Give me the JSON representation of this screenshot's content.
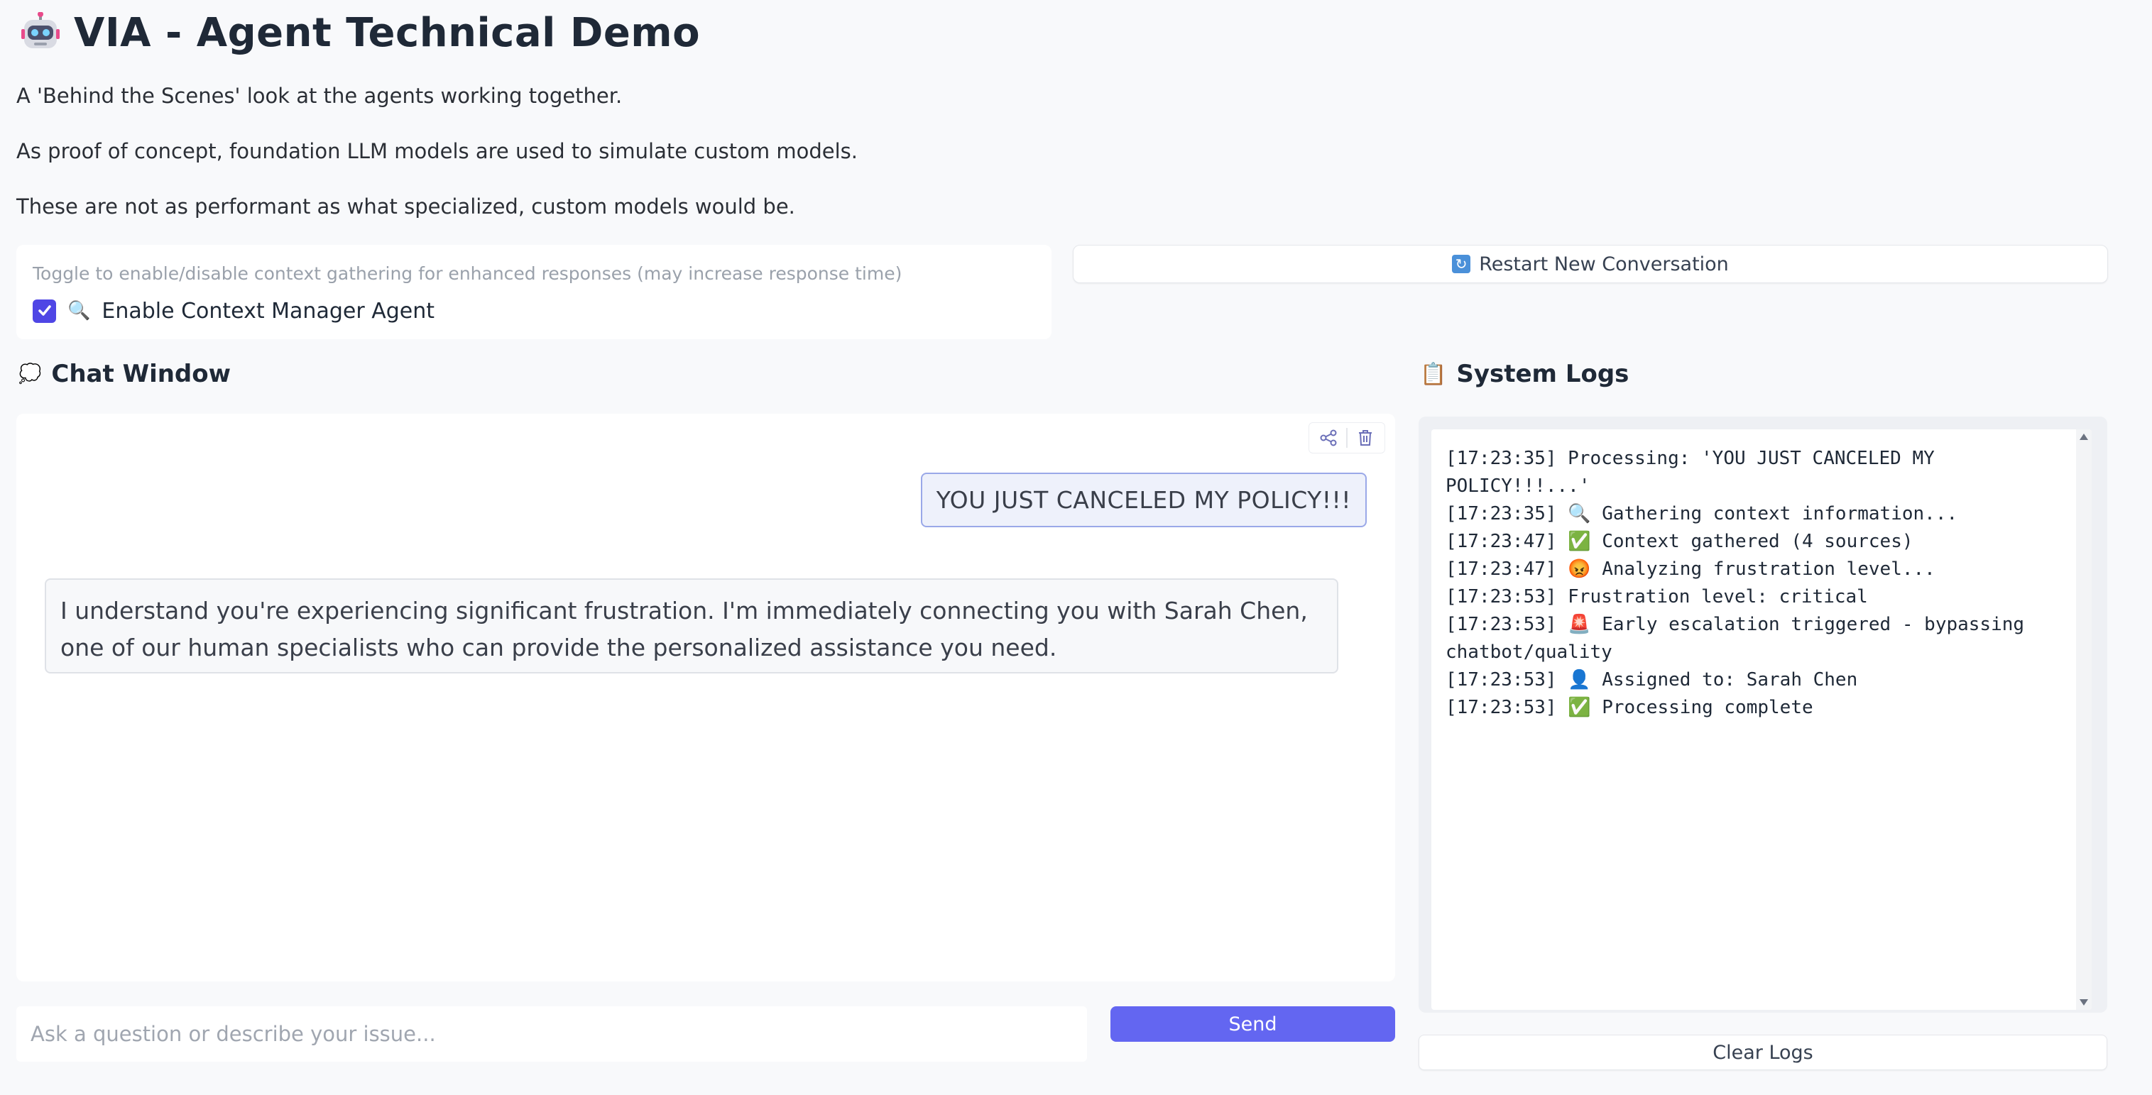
{
  "header": {
    "title": "VIA - Agent Technical Demo",
    "icon": "robot-icon",
    "descriptions": [
      "A 'Behind the Scenes' look at the agents working together.",
      "As proof of concept, foundation LLM models are used to simulate custom models.",
      "These are not as performant as what specialized, custom models would be."
    ]
  },
  "context_toggle": {
    "hint": "Toggle to enable/disable context gathering for enhanced responses (may increase response time)",
    "checked": true,
    "icon": "magnifier-icon",
    "icon_glyph": "🔍",
    "label": "Enable Context Manager Agent"
  },
  "restart": {
    "icon": "refresh-icon",
    "icon_glyph": "🔄",
    "label": "Restart New Conversation"
  },
  "chat": {
    "heading": "Chat Window",
    "heading_icon": "speech-bubble-icon",
    "heading_icon_glyph": "💭",
    "toolbar": [
      "share-icon",
      "trash-icon"
    ],
    "messages": [
      {
        "role": "user",
        "text": "YOU JUST CANCELED MY POLICY!!!"
      },
      {
        "role": "assistant",
        "text": "I understand you're experiencing significant frustration. I'm immediately connecting you with Sarah Chen, one of our human specialists who can provide the personalized assistance you need."
      }
    ],
    "input_placeholder": "Ask a question or describe your issue...",
    "input_value": "",
    "send_label": "Send"
  },
  "logs": {
    "heading": "System Logs",
    "heading_icon": "clipboard-icon",
    "heading_icon_glyph": "📋",
    "text": "[17:23:35] Processing: 'YOU JUST CANCELED MY POLICY!!!...'\n[17:23:35] 🔍 Gathering context information...\n[17:23:47] ✅ Context gathered (4 sources)\n[17:23:47] 😡 Analyzing frustration level...\n[17:23:53] Frustration level: critical\n[17:23:53] 🚨 Early escalation triggered - bypassing chatbot/quality\n[17:23:53] 👤 Assigned to: Sarah Chen\n[17:23:53] ✅ Processing complete",
    "clear_label": "Clear Logs"
  },
  "colors": {
    "accent": "#6366f1",
    "checkbox": "#4f46e5",
    "background": "#f8f9fb"
  }
}
